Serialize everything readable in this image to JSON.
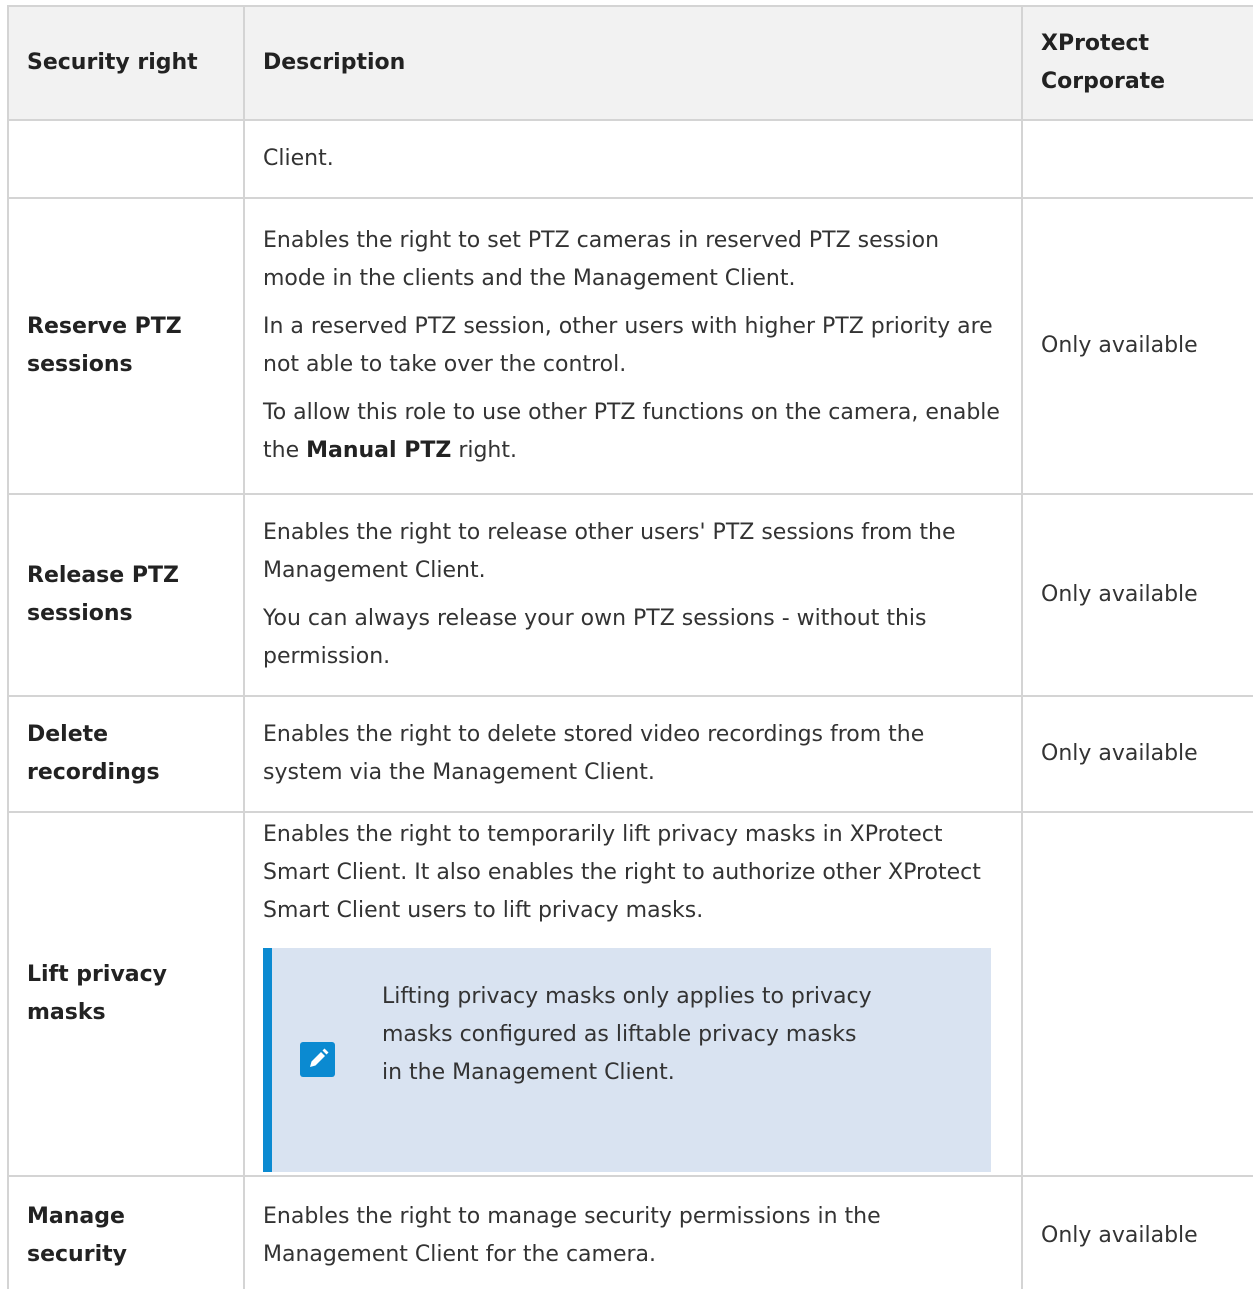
{
  "table": {
    "headers": {
      "security_right": "Security right",
      "description": "Description",
      "xprotect": "XProtect Corporate"
    },
    "continuation_row": {
      "description": "Client."
    },
    "rows": [
      {
        "right": "Reserve PTZ sessions",
        "paragraphs": [
          "Enables the right to set PTZ cameras in reserved PTZ session mode in the clients and the Management Client.",
          "In a reserved PTZ session, other users with higher PTZ priority are not able to take over the control."
        ],
        "last_paragraph_pre": "To allow this role to use other PTZ functions on the camera, enable the",
        "last_paragraph_bold": "Manual PTZ",
        "last_paragraph_post": "right.",
        "availability": "Only available"
      },
      {
        "right": "Release PTZ sessions",
        "paragraphs": [
          "Enables the right to release other users' PTZ sessions from the Management Client.",
          "You can always release your own PTZ sessions - without this permission."
        ],
        "availability": "Only available"
      },
      {
        "right": "Delete recordings",
        "paragraphs": [
          "Enables the right to delete stored video recordings from the system via the Management Client."
        ],
        "availability": "Only available"
      },
      {
        "right": "Lift privacy masks",
        "paragraphs": [
          "Enables the right to temporarily lift privacy masks in XProtect Smart Client. It also enables the right to authorize other XProtect Smart Client users to lift privacy masks."
        ],
        "note": "Lifting privacy masks only applies to privacy masks configured as liftable privacy masks in the Management Client.",
        "note_icon": "pencil-note-icon",
        "availability": ""
      },
      {
        "right": "Manage security",
        "paragraphs": [
          "Enables the right to manage security permissions in the Management Client for the camera."
        ],
        "availability": "Only available"
      }
    ]
  },
  "colors": {
    "note_background": "#d9e3f1",
    "note_accent": "#0b8ad1",
    "header_background": "#f2f2f2",
    "border": "#d4d4d4"
  }
}
